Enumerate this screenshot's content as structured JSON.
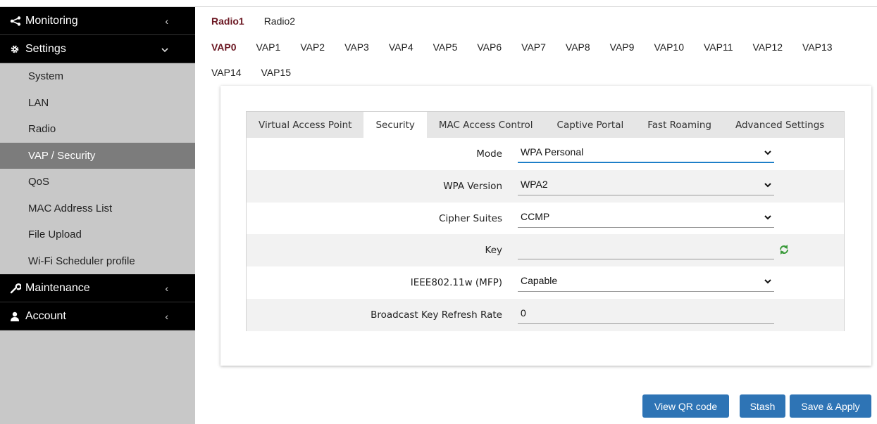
{
  "sidebar": {
    "monitoring": {
      "label": "Monitoring",
      "icon": "share-icon"
    },
    "settings": {
      "label": "Settings",
      "icon": "gear-icon"
    },
    "items": [
      {
        "label": "System"
      },
      {
        "label": "LAN"
      },
      {
        "label": "Radio"
      },
      {
        "label": "VAP / Security",
        "active": true
      },
      {
        "label": "QoS"
      },
      {
        "label": "MAC Address List"
      },
      {
        "label": "File Upload"
      },
      {
        "label": "Wi-Fi Scheduler profile"
      }
    ],
    "maintenance": {
      "label": "Maintenance",
      "icon": "wrench-icon"
    },
    "account": {
      "label": "Account",
      "icon": "user-icon"
    }
  },
  "radio_tabs": [
    "Radio1",
    "Radio2"
  ],
  "selected_radio": "Radio1",
  "vap_tabs_row1": [
    "VAP0",
    "VAP1",
    "VAP2",
    "VAP3",
    "VAP4",
    "VAP5",
    "VAP6",
    "VAP7",
    "VAP8",
    "VAP9",
    "VAP10",
    "VAP11",
    "VAP12",
    "VAP13"
  ],
  "vap_tabs_row2": [
    "VAP14",
    "VAP15"
  ],
  "selected_vap": "VAP0",
  "section_tabs": [
    "Virtual Access Point",
    "Security",
    "MAC Access Control",
    "Captive Portal",
    "Fast Roaming",
    "Advanced Settings"
  ],
  "selected_section": "Security",
  "form": {
    "mode": {
      "label": "Mode",
      "value": "WPA Personal"
    },
    "wpa_version": {
      "label": "WPA Version",
      "value": "WPA2"
    },
    "cipher_suites": {
      "label": "Cipher Suites",
      "value": "CCMP"
    },
    "key": {
      "label": "Key",
      "value": ""
    },
    "mfp": {
      "label": "IEEE802.11w (MFP)",
      "value": "Capable"
    },
    "refresh_rate": {
      "label": "Broadcast Key Refresh Rate",
      "value": "0"
    }
  },
  "buttons": {
    "view_qr": "View QR code",
    "stash": "Stash",
    "save_apply": "Save & Apply"
  },
  "colors": {
    "sidebar_bg": "#c8c8c8",
    "sidebar_head_bg": "#000000",
    "active_item_bg": "#7c7c7c",
    "selected_tab_color": "#6b1722",
    "button_bg": "#2e74b5",
    "focus_underline": "#1e7fc8"
  }
}
